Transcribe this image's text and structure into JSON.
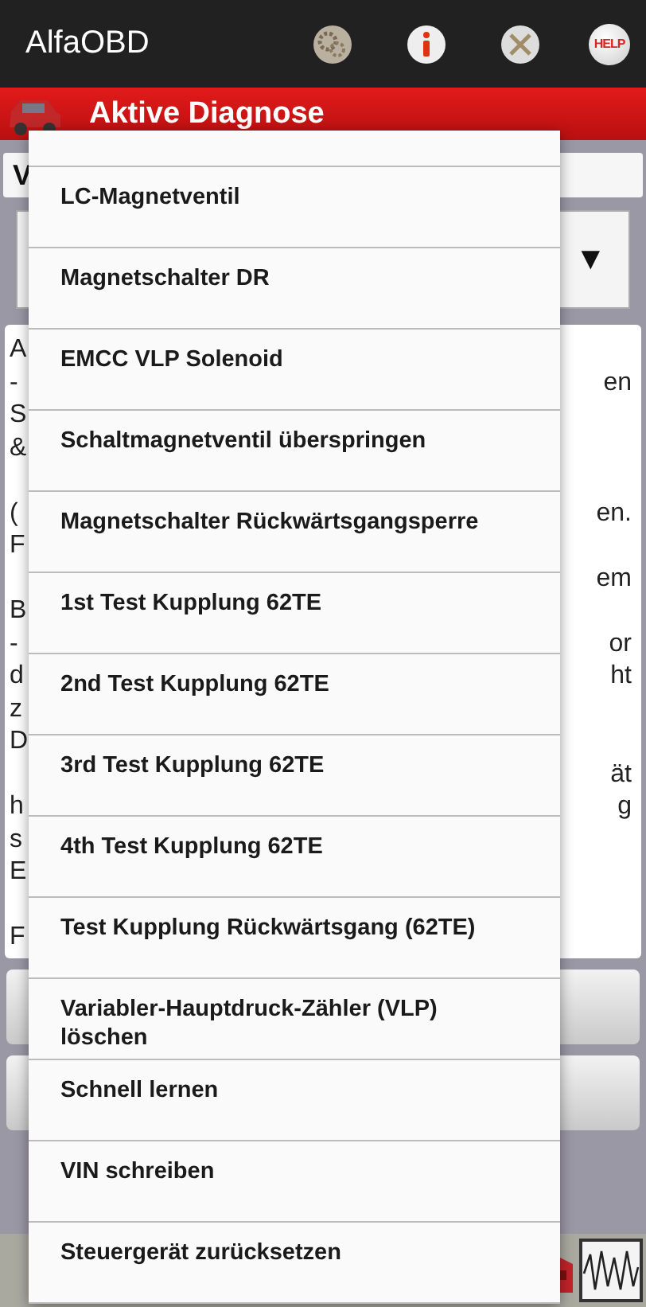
{
  "app_bar": {
    "title": "AlfaOBD",
    "help_label": "HELP"
  },
  "header": {
    "title": "Aktive Diagnose"
  },
  "field": {
    "value": "V"
  },
  "spinner": {
    "arrow": "▼"
  },
  "description_lines": [
    {
      "left": "A"
    },
    {
      "left": "-",
      "right": "en"
    },
    {
      "left": "S"
    },
    {
      "left": "&"
    },
    {
      "kind": "blank"
    },
    {
      "left": "(",
      "right": "en."
    },
    {
      "left": "F"
    },
    {
      "right": "em"
    },
    {
      "left": "B"
    },
    {
      "left": "-",
      "right": "or"
    },
    {
      "left": "d",
      "right": "ht"
    },
    {
      "left": "z"
    },
    {
      "left": "D"
    },
    {
      "right": "ät"
    },
    {
      "left": "h",
      "right": "g"
    },
    {
      "left": "s"
    },
    {
      "left": "E"
    },
    {
      "kind": "blank"
    },
    {
      "left": "F"
    }
  ],
  "menu": {
    "items": [
      {
        "label": "LC-Magnetventil"
      },
      {
        "label": "Magnetschalter DR"
      },
      {
        "label": "EMCC VLP Solenoid"
      },
      {
        "label": "Schaltmagnetventil überspringen"
      },
      {
        "label": "Magnetschalter Rückwärtsgangsperre"
      },
      {
        "label": "1st Test Kupplung 62TE"
      },
      {
        "label": "2nd Test Kupplung 62TE"
      },
      {
        "label": "3rd Test Kupplung 62TE"
      },
      {
        "label": "4th Test Kupplung 62TE"
      },
      {
        "label": "Test Kupplung Rückwärtsgang (62TE)"
      },
      {
        "label": "Variabler-Hauptdruck-Zähler (VLP) löschen"
      },
      {
        "label": "Schnell lernen"
      },
      {
        "label": "VIN schreiben"
      },
      {
        "label": "Steuergerät zurücksetzen"
      }
    ]
  }
}
